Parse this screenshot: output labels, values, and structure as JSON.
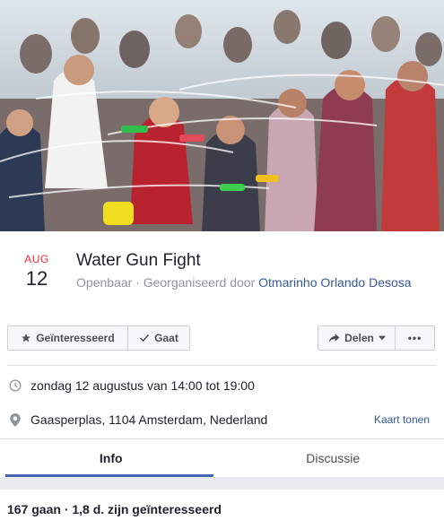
{
  "event": {
    "month": "AUG",
    "day": "12",
    "title": "Water Gun Fight",
    "privacy": "Openbaar",
    "organizer_prefix": "· Georganiseerd door",
    "organizer": "Otmarinho Orlando Desosa"
  },
  "actions": {
    "interested_label": "Geïnteresseerd",
    "going_label": "Gaat",
    "share_label": "Delen",
    "more_label": "•••"
  },
  "details": {
    "time": "zondag 12 augustus van 14:00 tot 19:00",
    "location": "Gaasperplas, 1104 Amsterdam, Nederland",
    "map_link": "Kaart tonen"
  },
  "tabs": [
    {
      "label": "Info",
      "active": true
    },
    {
      "label": "Discussie",
      "active": false
    }
  ],
  "stats": "167 gaan · 1,8 d. zijn geïnteresseerd",
  "colors": {
    "month_red": "#e62c35",
    "link_blue": "#385898",
    "tab_underline": "#4267b2"
  },
  "icons": [
    "star-icon",
    "check-icon",
    "share-arrow-icon",
    "caret-down-icon",
    "clock-icon",
    "location-pin-icon"
  ]
}
